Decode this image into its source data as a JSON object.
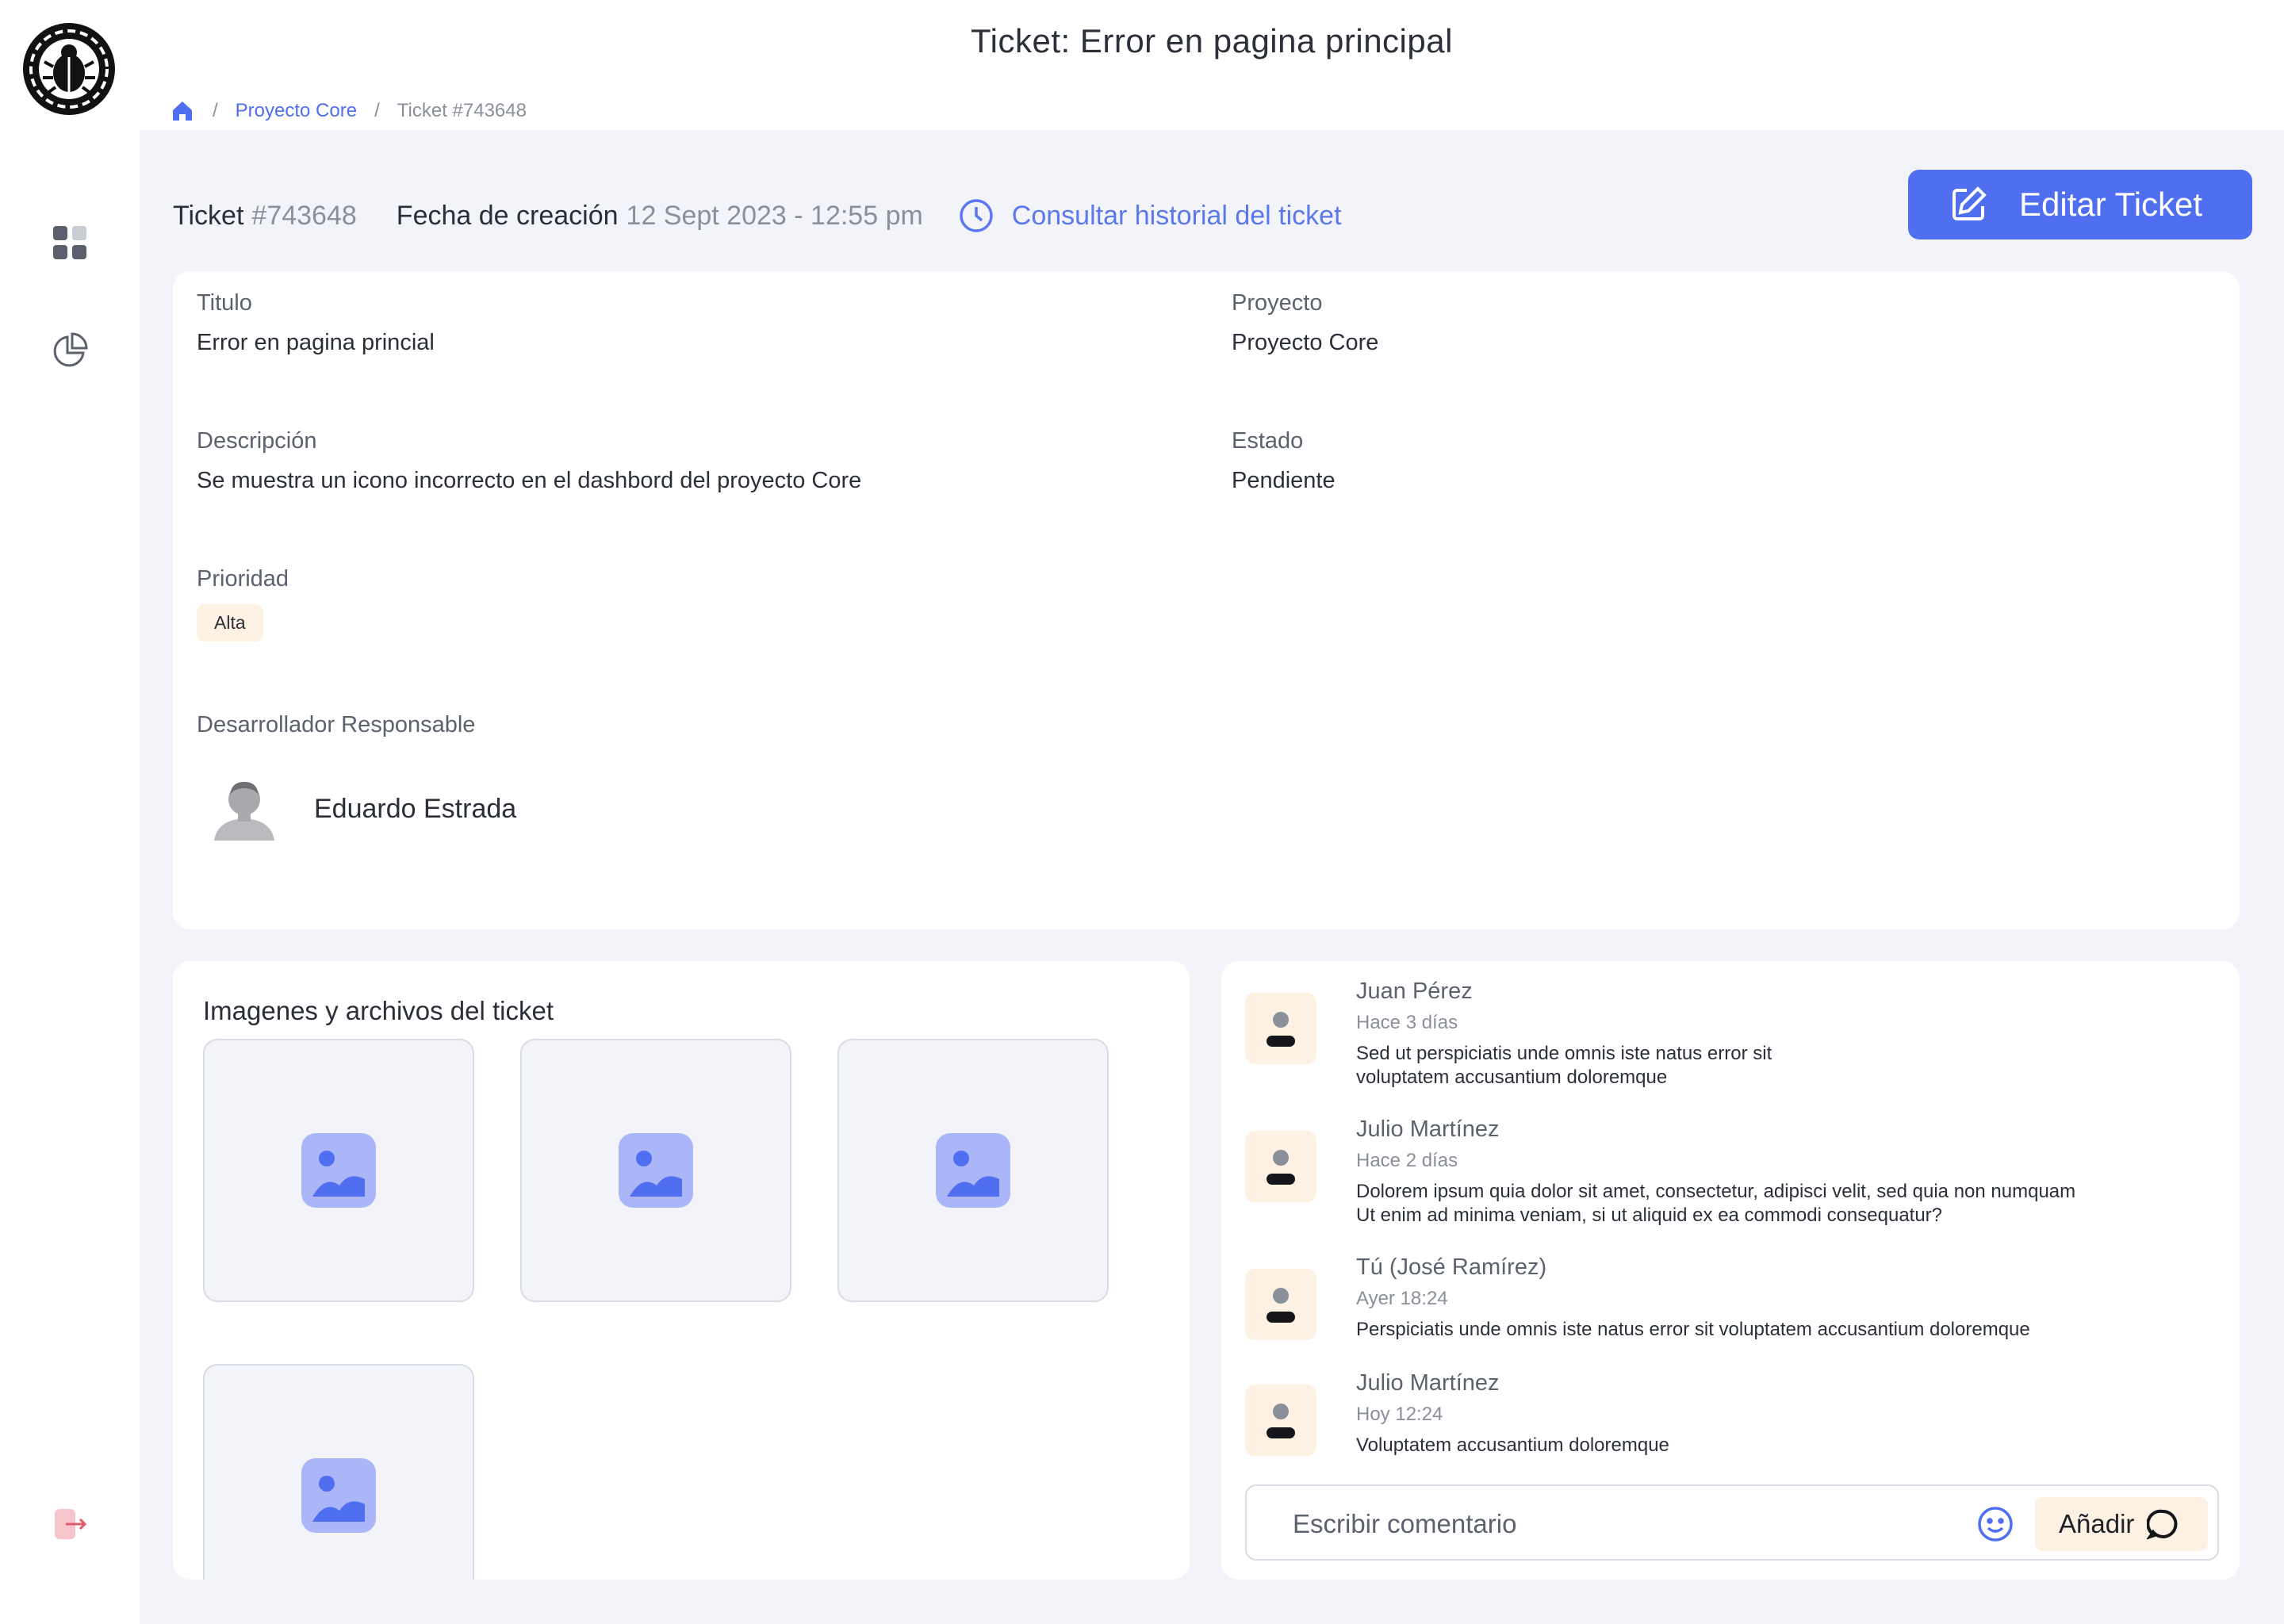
{
  "header": {
    "title": "Ticket: Error en pagina principal"
  },
  "breadcrumb": {
    "project": "Proyecto Core",
    "current": "Ticket #743648",
    "separator": "/"
  },
  "ticket_bar": {
    "ticket_label": "Ticket",
    "ticket_id": "#743648",
    "created_label": "Fecha de creación",
    "created_value": "12 Sept 2023 - 12:55 pm",
    "history_link": "Consultar historial del ticket",
    "edit_button": "Editar Ticket"
  },
  "details": {
    "title_label": "Titulo",
    "title_value": "Error en pagina princial",
    "project_label": "Proyecto",
    "project_value": "Proyecto Core",
    "description_label": "Descripción",
    "description_value": "Se muestra un icono incorrecto en el dashbord del proyecto Core",
    "status_label": "Estado",
    "status_value": "Pendiente",
    "priority_label": "Prioridad",
    "priority_value": "Alta",
    "developer_label": "Desarrollador Responsable",
    "developer_name": "Eduardo Estrada"
  },
  "files": {
    "title": "Imagenes y archivos del ticket",
    "items": [
      "image-placeholder-icon",
      "image-placeholder-icon",
      "image-placeholder-icon",
      "image-placeholder-icon"
    ]
  },
  "comments": {
    "items": [
      {
        "author": "Juan Pérez",
        "time": "Hace 3 días",
        "text_1": "Sed ut perspiciatis unde omnis iste natus error sit",
        "text_2": "voluptatem accusantium doloremque"
      },
      {
        "author": "Julio Martínez",
        "time": "Hace 2 días",
        "text_1": "Dolorem ipsum quia dolor sit amet, consectetur, adipisci velit, sed quia non numquam",
        "text_2": "Ut enim ad minima veniam, si ut aliquid ex ea commodi consequatur?"
      },
      {
        "author": "Tú (José Ramírez)",
        "time": "Ayer 18:24",
        "text_1": "Perspiciatis unde omnis iste natus error sit voluptatem accusantium doloremque",
        "text_2": ""
      },
      {
        "author": "Julio Martínez",
        "time": "Hoy 12:24",
        "text_1": "Voluptatem accusantium doloremque",
        "text_2": ""
      }
    ],
    "input_placeholder": "Escribir comentario",
    "add_button": "Añadir"
  },
  "colors": {
    "accent": "#4f6ef0",
    "priority_badge_bg": "#fdf1e3",
    "page_bg": "#f3f4f9",
    "logout": "#e05b6a"
  }
}
